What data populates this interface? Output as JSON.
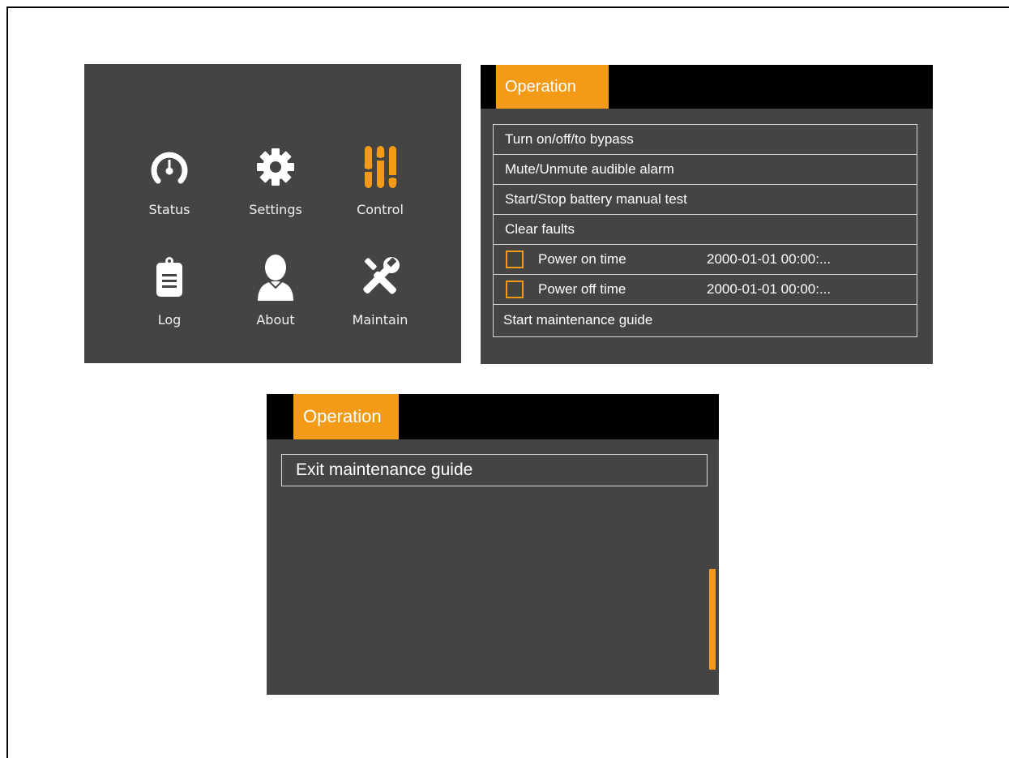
{
  "menu": {
    "items": [
      {
        "label": "Status",
        "icon": "gauge-icon"
      },
      {
        "label": "Settings",
        "icon": "gear-icon"
      },
      {
        "label": "Control",
        "icon": "sliders-icon",
        "active": true
      },
      {
        "label": "Log",
        "icon": "clipboard-icon"
      },
      {
        "label": "About",
        "icon": "person-icon"
      },
      {
        "label": "Maintain",
        "icon": "tools-icon"
      }
    ]
  },
  "operation_panel": {
    "tab_title": "Operation",
    "rows": [
      "Turn on/off/to bypass",
      "Mute/Unmute audible alarm",
      "Start/Stop battery manual test",
      "Clear faults"
    ],
    "timers": [
      {
        "label": "Power on time",
        "value": "2000-01-01 00:00:...",
        "checked": false
      },
      {
        "label": "Power off time",
        "value": "2000-01-01 00:00:...",
        "checked": false
      }
    ],
    "last_row": "Start maintenance guide"
  },
  "maintenance_panel": {
    "tab_title": "Operation",
    "exit_row": "Exit maintenance guide"
  },
  "colors": {
    "accent": "#f39a16",
    "panel_bg": "#444444",
    "header_bg": "#000000",
    "text": "#ffffff"
  }
}
